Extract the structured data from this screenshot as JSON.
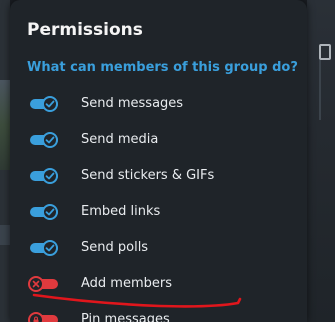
{
  "dialog": {
    "title": "Permissions",
    "subtitle": "What can members of this group do?"
  },
  "permissions": [
    {
      "label": "Send messages",
      "state": "on"
    },
    {
      "label": "Send media",
      "state": "on"
    },
    {
      "label": "Send stickers & GIFs",
      "state": "on"
    },
    {
      "label": "Embed links",
      "state": "on"
    },
    {
      "label": "Send polls",
      "state": "on"
    },
    {
      "label": "Add members",
      "state": "off"
    },
    {
      "label": "Pin messages",
      "state": "off"
    }
  ],
  "colors": {
    "accent": "#3a9fdc",
    "off": "#e03a3e",
    "annotation": "#e0161c",
    "dialog_bg": "#1f2429"
  },
  "icons": {
    "on": "check-icon",
    "off": "cross-icon",
    "locked": "lock-icon"
  }
}
